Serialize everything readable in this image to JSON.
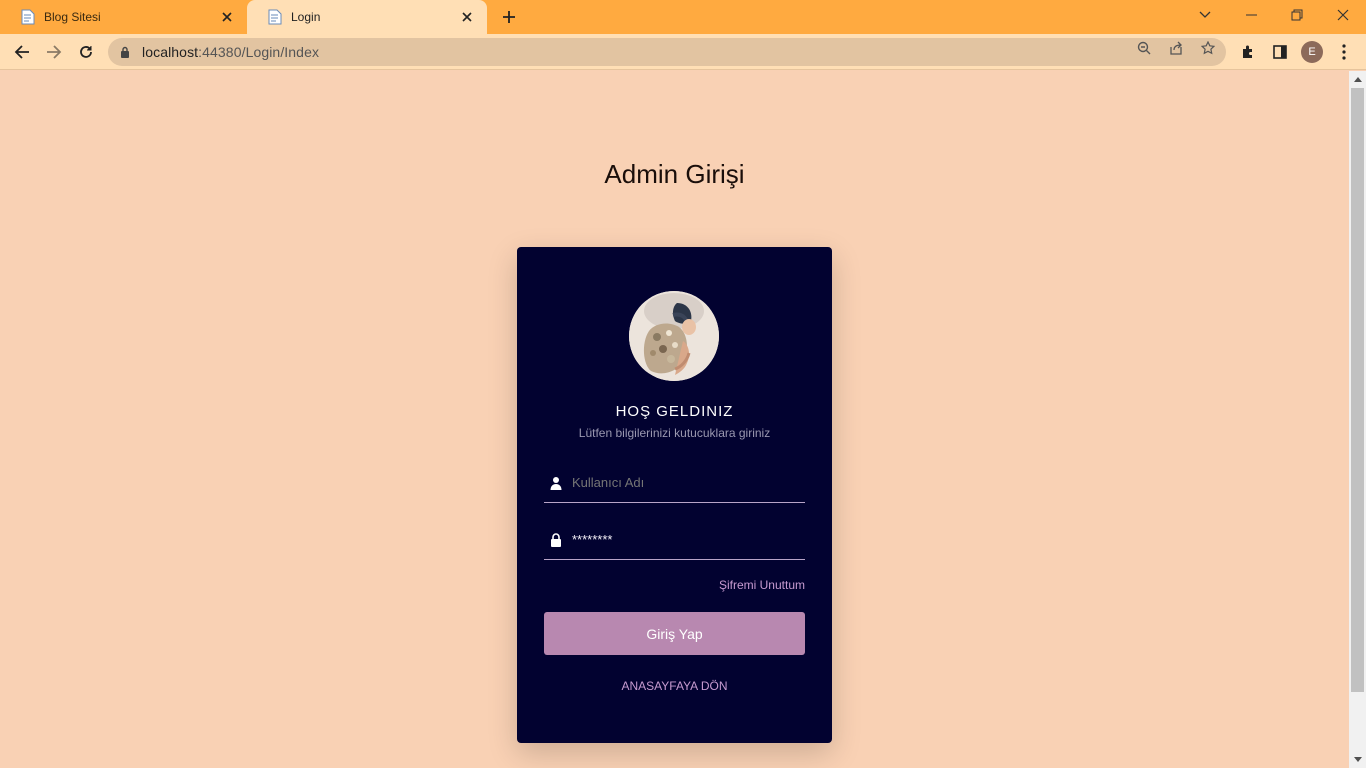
{
  "browser": {
    "tabs": [
      {
        "title": "Blog Sitesi",
        "active": false
      },
      {
        "title": "Login",
        "active": true
      }
    ],
    "url_host": "localhost",
    "url_rest": ":44380/Login/Index",
    "profile_initial": "E",
    "colors": {
      "tabstrip": "#ffaa40",
      "toolbar": "#ffdfb5",
      "omnibox": "#e2c4a1"
    }
  },
  "page": {
    "title": "Admin Girişi",
    "background": "#f9d1b4"
  },
  "card": {
    "welcome": "HOŞ GELDINIZ",
    "subtext": "Lütfen bilgilerinizi kutucuklara giriniz",
    "username_placeholder": "Kullanıcı Adı",
    "password_value": "********",
    "forgot_link": "Şifremi Unuttum",
    "login_button": "Giriş Yap",
    "home_link": "ANASAYFAYA DÖN",
    "colors": {
      "card": "#020230",
      "button": "#b888b0",
      "link": "#c79bd0"
    }
  }
}
